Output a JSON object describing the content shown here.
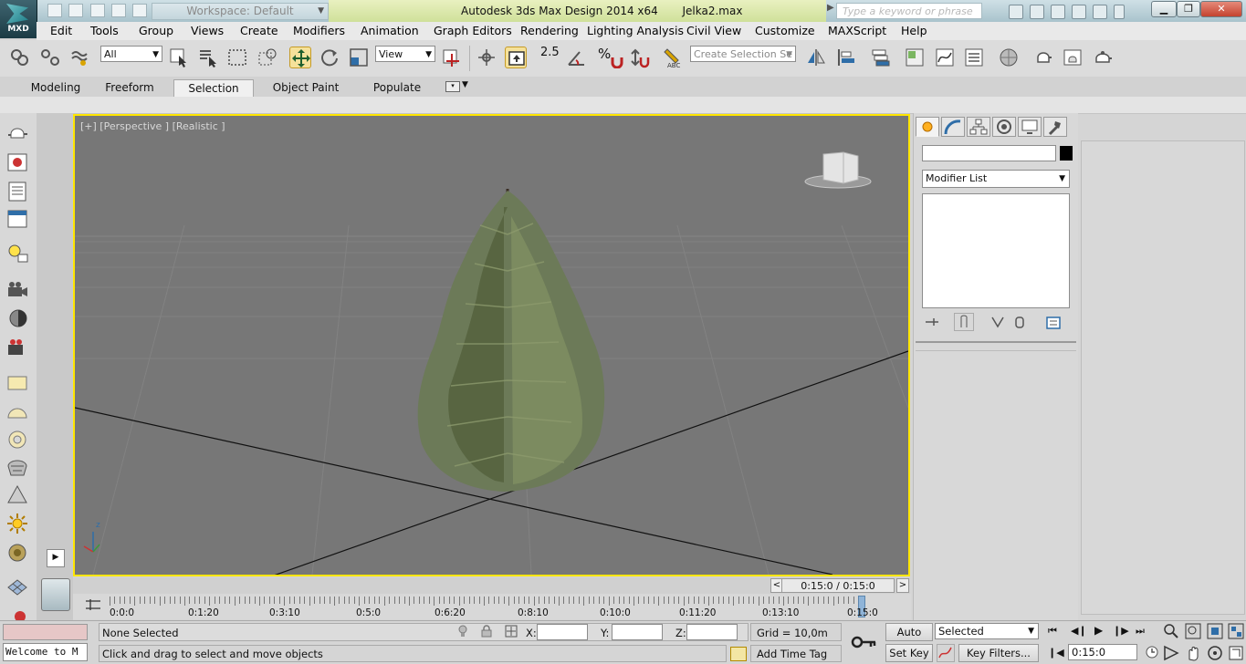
{
  "titlebar": {
    "workspace_label": "Workspace: Default",
    "title": "Autodesk 3ds Max Design 2014 x64       Jelka2.max",
    "search_placeholder": "Type a keyword or phrase"
  },
  "logo": {
    "text": "MXD"
  },
  "menu": [
    "Edit",
    "Tools",
    "Group",
    "Views",
    "Create",
    "Modifiers",
    "Animation",
    "Graph Editors",
    "Rendering",
    "Lighting Analysis",
    "Civil View",
    "Customize",
    "MAXScript",
    "Help"
  ],
  "toolbar": {
    "filter_value": "All",
    "refcoord_value": "View",
    "snap_value": "2.5",
    "angle_snap_label": "%",
    "named_selection_placeholder": "Create Selection Se"
  },
  "ribbon_tabs": [
    "Modeling",
    "Freeform",
    "Selection",
    "Object Paint",
    "Populate"
  ],
  "viewport": {
    "label": "[+] [Perspective ] [Realistic ]",
    "axis_z": "z"
  },
  "command_panel": {
    "modifier_list": "Modifier List"
  },
  "timeline": {
    "slider_value": "0:15:0 / 0:15:0",
    "frames": [
      "0:0:0",
      "0:1:20",
      "0:3:10",
      "0:5:0",
      "0:6:20",
      "0:8:10",
      "0:10:0",
      "0:11:20",
      "0:13:10",
      "0:15:0"
    ]
  },
  "status": {
    "maxscript_text": "Welcome to M",
    "selection": "None Selected",
    "prompt": "Click and drag to select and move objects",
    "x_label": "X:",
    "y_label": "Y:",
    "z_label": "Z:",
    "grid": "Grid = 10,0m",
    "add_time_tag": "Add Time Tag",
    "auto_key": "Auto Key",
    "set_key": "Set Key",
    "key_mode_value": "Selected",
    "key_filters": "Key Filters...",
    "current_time": "0:15:0"
  }
}
